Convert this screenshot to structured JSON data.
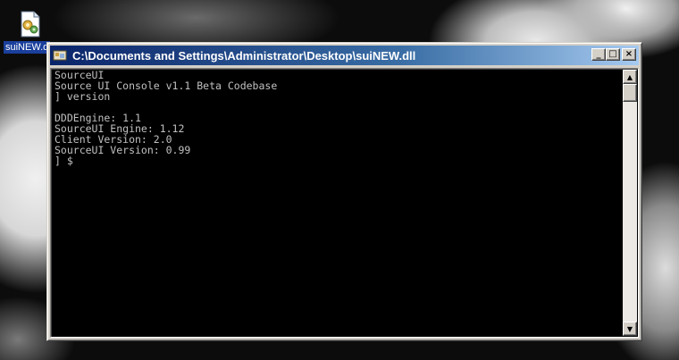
{
  "desktop": {
    "icon": {
      "name": "dll-file-icon",
      "label": "suiNEW.dll"
    }
  },
  "window": {
    "title": "C:\\Documents and Settings\\Administrator\\Desktop\\suiNEW.dll",
    "icon": "console-app-icon",
    "controls": {
      "minimize_glyph": "_",
      "maximize_glyph": "□",
      "close_glyph": "×"
    }
  },
  "console": {
    "lines": [
      "SourceUI",
      "Source UI Console v1.1 Beta Codebase",
      "] version",
      "",
      "DDDEngine: 1.1",
      "SourceUI Engine: 1.12",
      "Client Version: 2.0",
      "SourceUI Version: 0.99",
      "] $"
    ],
    "text_color": "#c0c0c0",
    "background": "#000000"
  },
  "scrollbar": {
    "up_glyph": "▲",
    "down_glyph": "▼"
  },
  "colors": {
    "titlebar_start": "#0a246a",
    "titlebar_end": "#a6caf0",
    "chrome": "#d4d0c8"
  }
}
